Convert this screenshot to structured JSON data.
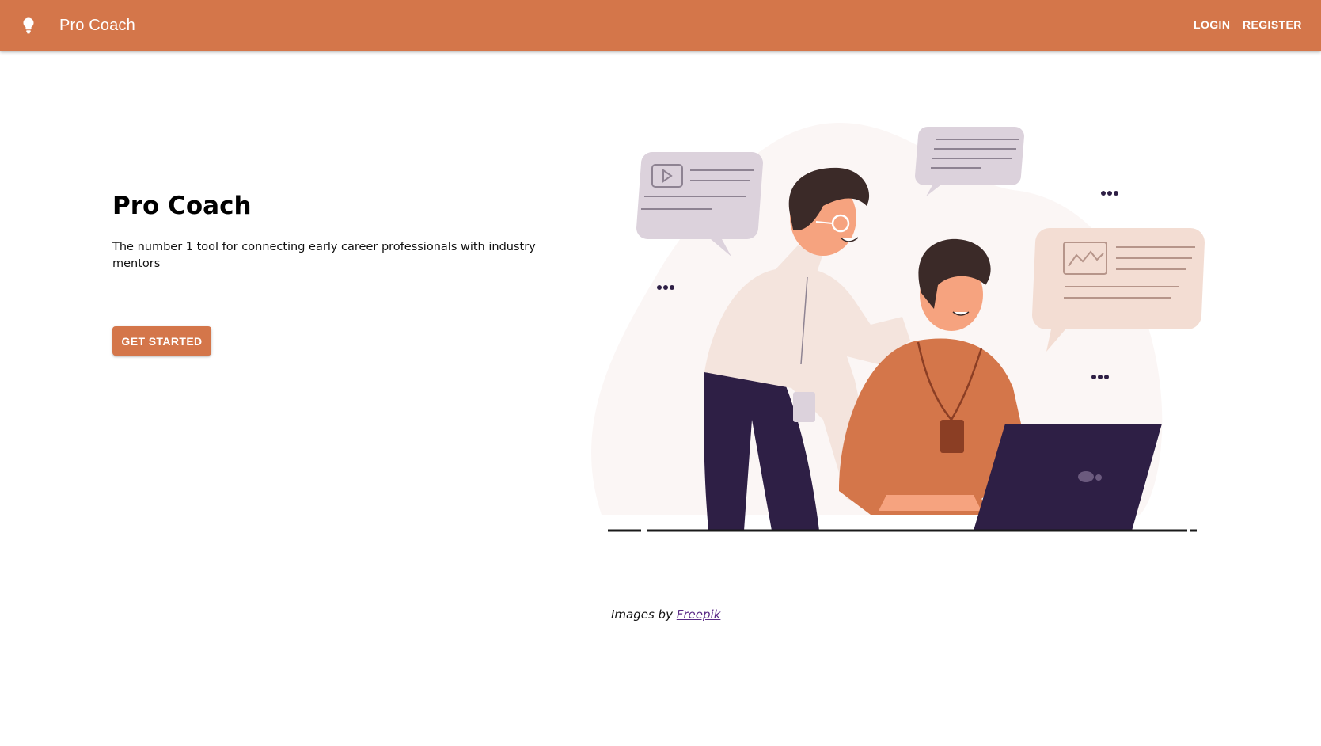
{
  "app": {
    "brand_title": "Pro Coach",
    "brand_icon": "lightbulb-icon"
  },
  "nav": {
    "login_label": "LOGIN",
    "register_label": "REGISTER"
  },
  "hero": {
    "title": "Pro Coach",
    "subtitle": "The number 1 tool for connecting early career professionals with industry mentors",
    "cta_label": "GET STARTED"
  },
  "illustration": {
    "name": "two-people-mentoring-illustration"
  },
  "credit": {
    "prefix": "Images by",
    "link_text": "Freepik"
  },
  "colors": {
    "accent": "#D4764A",
    "illustration_dark": "#2E1F45",
    "bubble_lavender": "#DCD2DC",
    "bubble_peach": "#F3DDD3",
    "background_blob": "#FBF6F5"
  }
}
